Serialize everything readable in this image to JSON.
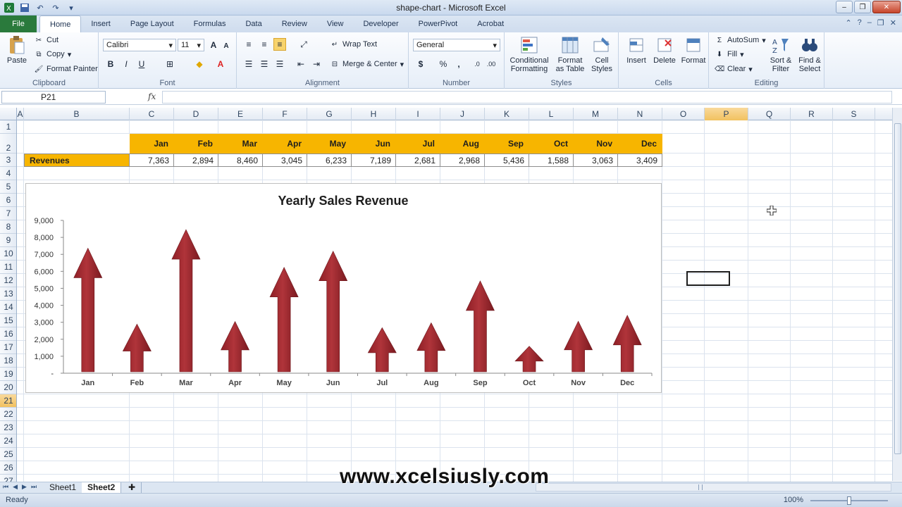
{
  "titlebar": {
    "title": "shape-chart - Microsoft Excel"
  },
  "tabs": {
    "file": "File",
    "items": [
      "Home",
      "Insert",
      "Page Layout",
      "Formulas",
      "Data",
      "Review",
      "View",
      "Developer",
      "PowerPivot",
      "Acrobat"
    ]
  },
  "ribbon": {
    "clipboard": {
      "paste": "Paste",
      "cut": "Cut",
      "copy": "Copy",
      "format_painter": "Format Painter",
      "label": "Clipboard"
    },
    "font": {
      "name": "Calibri",
      "size": "11",
      "label": "Font"
    },
    "alignment": {
      "wrap": "Wrap Text",
      "merge": "Merge & Center",
      "label": "Alignment"
    },
    "number": {
      "format": "General",
      "label": "Number"
    },
    "styles": {
      "conditional1": "Conditional",
      "conditional2": "Formatting",
      "table1": "Format",
      "table2": "as Table",
      "cell1": "Cell",
      "cell2": "Styles",
      "label": "Styles"
    },
    "cells": {
      "insert": "Insert",
      "delete": "Delete",
      "format": "Format",
      "label": "Cells"
    },
    "editing": {
      "autosum": "AutoSum",
      "fill": "Fill",
      "clear": "Clear",
      "sort1": "Sort &",
      "sort2": "Filter",
      "find1": "Find &",
      "find2": "Select",
      "label": "Editing"
    }
  },
  "formula_bar": {
    "name_box": "P21",
    "fx": "fx",
    "value": ""
  },
  "grid": {
    "columns": [
      "A",
      "B",
      "C",
      "D",
      "E",
      "F",
      "G",
      "H",
      "I",
      "J",
      "K",
      "L",
      "M",
      "N",
      "O",
      "P",
      "Q",
      "R",
      "S"
    ],
    "selected_column": "P",
    "rows": [
      "1",
      "2",
      "3",
      "4",
      "5",
      "6",
      "7",
      "8",
      "9",
      "10",
      "11",
      "12",
      "13",
      "14",
      "15",
      "16",
      "17",
      "18",
      "19",
      "20",
      "21",
      "22",
      "23",
      "24",
      "25",
      "26",
      "27"
    ],
    "selected_row": "21"
  },
  "table": {
    "months": [
      "Jan",
      "Feb",
      "Mar",
      "Apr",
      "May",
      "Jun",
      "Jul",
      "Aug",
      "Sep",
      "Oct",
      "Nov",
      "Dec"
    ],
    "row_label": "Revenues",
    "values": [
      "7,363",
      "2,894",
      "8,460",
      "3,045",
      "6,233",
      "7,189",
      "2,681",
      "2,968",
      "5,436",
      "1,588",
      "3,063",
      "3,409"
    ]
  },
  "chart_data": {
    "type": "bar",
    "title": "Yearly Sales Revenue",
    "categories": [
      "Jan",
      "Feb",
      "Mar",
      "Apr",
      "May",
      "Jun",
      "Jul",
      "Aug",
      "Sep",
      "Oct",
      "Nov",
      "Dec"
    ],
    "values": [
      7363,
      2894,
      8460,
      3045,
      6233,
      7189,
      2681,
      2968,
      5436,
      1588,
      3063,
      3409
    ],
    "ylim": [
      0,
      9000
    ],
    "yticks": [
      "9,000",
      "8,000",
      "7,000",
      "6,000",
      "5,000",
      "4,000",
      "3,000",
      "2,000",
      "1,000",
      "-"
    ],
    "grid": false,
    "bar_color": "#b0343a"
  },
  "sheets": {
    "tabs": [
      "Sheet1",
      "Sheet2"
    ],
    "active": "Sheet2"
  },
  "watermark": "www.xcelsiusly.com",
  "status": {
    "ready": "Ready",
    "zoom": "100%"
  }
}
